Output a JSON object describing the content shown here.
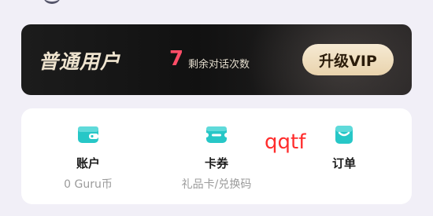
{
  "vip_banner": {
    "user_type": "普通用户",
    "remaining_count": "7",
    "remaining_label": "剩余对话次数",
    "upgrade_label": "升级VIP"
  },
  "menu": [
    {
      "label": "账户",
      "sub": "0 Guru币",
      "icon": "wallet-icon"
    },
    {
      "label": "卡券",
      "sub": "礼品卡/兑换码",
      "icon": "ticket-icon"
    },
    {
      "label": "订单",
      "sub": "",
      "icon": "order-icon"
    }
  ],
  "watermark": "qqtf",
  "colors": {
    "icon_accent": "#27c7c7",
    "count_red": "#ff4d67",
    "upgrade_gold": "#efdcbc"
  }
}
